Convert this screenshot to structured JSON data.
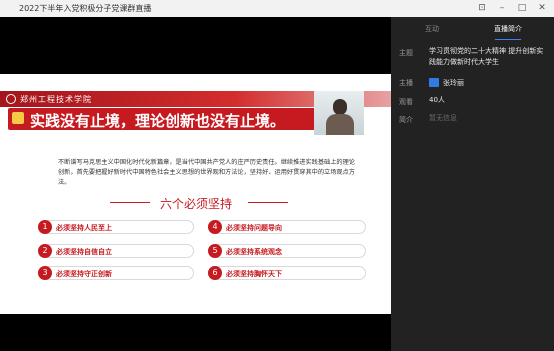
{
  "app": {
    "title": "2022下半年入党积极分子党课群直播",
    "window_icons": [
      "pin-icon",
      "minimize-icon",
      "maximize-icon",
      "close-icon"
    ]
  },
  "slide": {
    "school_name": "郑州工程技术学院",
    "banner_title": "实践没有止境，理论创新也没有止境。",
    "quote": "不断谱写马克思主义中国化时代化新篇章，是当代中国共产党人的庄严历史责任。继续推进实践基础上的理论创新，首先要把握好新时代中国特色社会主义思想的世界观和方法论，坚持好、运用好贯穿其中的立场观点方法。",
    "section_title": "六个必须坚持",
    "items": [
      {
        "num": "1",
        "label": "必须坚持人民至上"
      },
      {
        "num": "2",
        "label": "必须坚持自信自立"
      },
      {
        "num": "3",
        "label": "必须坚持守正创新"
      },
      {
        "num": "4",
        "label": "必须坚持问题导向"
      },
      {
        "num": "5",
        "label": "必须坚持系统观念"
      },
      {
        "num": "6",
        "label": "必须坚持胸怀天下"
      }
    ],
    "accent_color": "#c51a1f"
  },
  "sidebar": {
    "tabs": [
      {
        "label": "互动",
        "active": false
      },
      {
        "label": "直播简介",
        "active": true
      }
    ],
    "info": {
      "topic_label": "主题",
      "topic_value": "学习贯彻党的二十大精神 提升创新实践能力做新时代大学生",
      "host_label": "主播",
      "host_badge": "",
      "host_value": "张玲丽",
      "views_label": "观看",
      "views_value": "40人",
      "intro_label": "简介",
      "intro_value": "暂无信息"
    }
  }
}
